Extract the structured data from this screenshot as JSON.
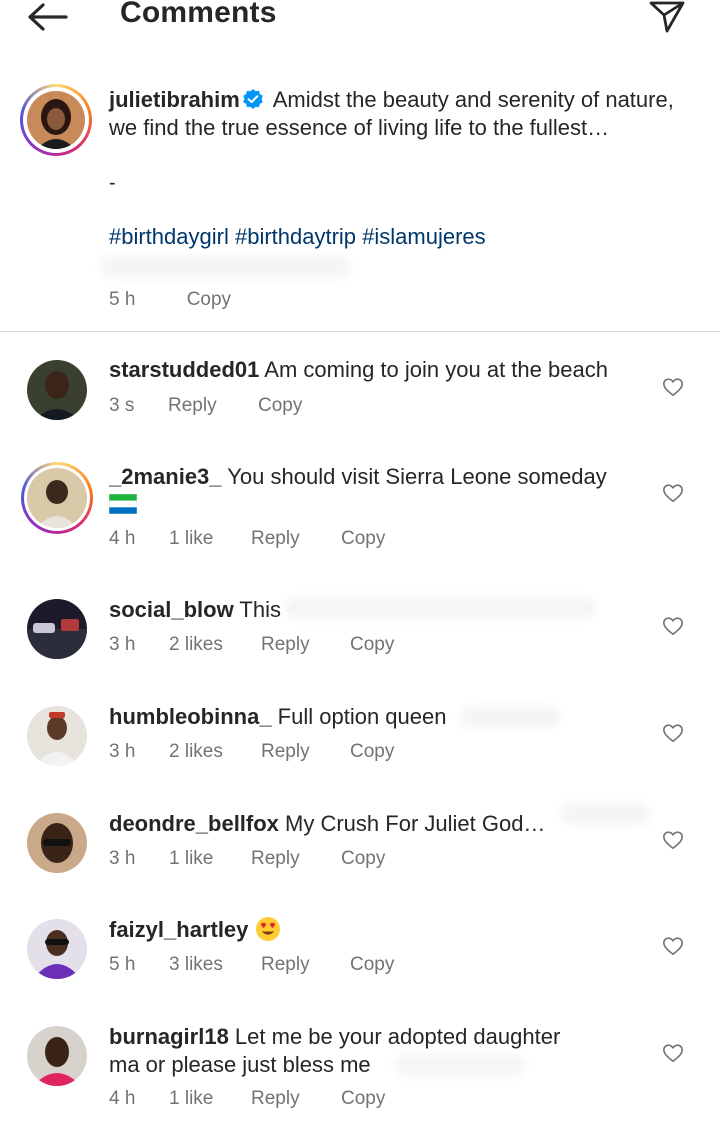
{
  "header": {
    "title": "Comments"
  },
  "caption": {
    "username": "julietibrahim",
    "text": " Amidst the beauty and serenity of nature, we find the true essence of living life to the fullest…",
    "dash": "-",
    "hashtags": [
      "#birthdaygirl",
      "#birthdaytrip",
      "#islamujeres"
    ],
    "time": "5 h",
    "copy_label": "Copy"
  },
  "comments": [
    {
      "username": "starstudded01",
      "text": " Am coming to join you at the beach",
      "time": "3 s",
      "likes": "",
      "reply": "Reply",
      "copy": "Copy"
    },
    {
      "username": "_2manie3_",
      "text": " You should visit Sierra Leone someday",
      "time": "4 h",
      "likes": "1 like",
      "reply": "Reply",
      "copy": "Copy"
    },
    {
      "username": "social_blow",
      "text": " This",
      "time": "3 h",
      "likes": "2 likes",
      "reply": "Reply",
      "copy": "Copy"
    },
    {
      "username": "humbleobinna_",
      "text": " Full option queen",
      "time": "3 h",
      "likes": "2 likes",
      "reply": "Reply",
      "copy": "Copy"
    },
    {
      "username": "deondre_bellfox",
      "text": " My Crush For Juliet God…",
      "time": "3 h",
      "likes": "1 like",
      "reply": "Reply",
      "copy": "Copy"
    },
    {
      "username": "faizyl_hartley",
      "text": " ",
      "time": "5 h",
      "likes": "3 likes",
      "reply": "Reply",
      "copy": "Copy"
    },
    {
      "username": "burnagirl18",
      "text": " Let me be your adopted daughter ma or please just bless me",
      "time": "4 h",
      "likes": "1 like",
      "reply": "Reply",
      "copy": "Copy"
    }
  ],
  "icons": {
    "back": "arrow-left-icon",
    "send": "paper-plane-icon",
    "verified": "verified-badge-icon",
    "like": "heart-outline-icon",
    "flag": "sierra-leone-flag-icon",
    "emoji": "heart-eyes-emoji-icon"
  },
  "colors": {
    "text": "#262626",
    "secondary": "#737373",
    "hashtag": "#00376b",
    "verified": "#0095f6"
  }
}
